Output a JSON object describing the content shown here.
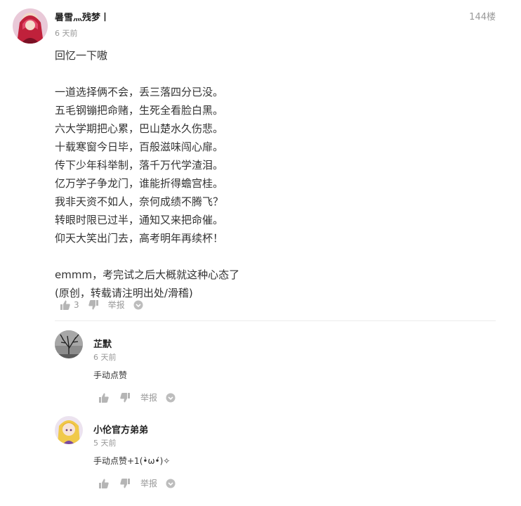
{
  "main_comment": {
    "username": "暑雪灬残梦丨",
    "time": "6 天前",
    "floor": "144楼",
    "lines": [
      "回忆一下嗷",
      "",
      "一道选择俩不会，丢三落四分已没。",
      "五毛钢镚把命赌，生死全看脸白黑。",
      "六大学期把心累，巴山楚水久伤悲。",
      "十载寒窗今日毕，百般滋味闯心扉。",
      "传下少年科举制，落千万代学渣泪。",
      "亿万学子争龙门，谁能折得蟾宫桂。",
      "我非天资不如人，奈何成绩不腾飞？",
      "转眼时限已过半，通知又来把命催。",
      "仰天大笑出门去，高考明年再续杯！",
      "",
      "emmm，考完试之后大概就这种心态了",
      "(原创，转载请注明出处/滑稽)"
    ],
    "like_count": "3",
    "report_label": "举报"
  },
  "replies": [
    {
      "username": "芷默",
      "time": "6 天前",
      "text": "手动点赞",
      "report_label": "举报"
    },
    {
      "username": "小伦官方弟弟",
      "time": "5 天前",
      "text": "手动点赞+1(•̀ω•́)✧",
      "report_label": "举报"
    }
  ],
  "icons": {
    "like": "thumbs-up-icon",
    "dislike": "thumbs-down-icon",
    "more": "chevron-down-circle-icon"
  },
  "colors": {
    "muted": "#999999",
    "icon": "#b5b5b5",
    "divider": "#ececec",
    "text": "#333333"
  }
}
